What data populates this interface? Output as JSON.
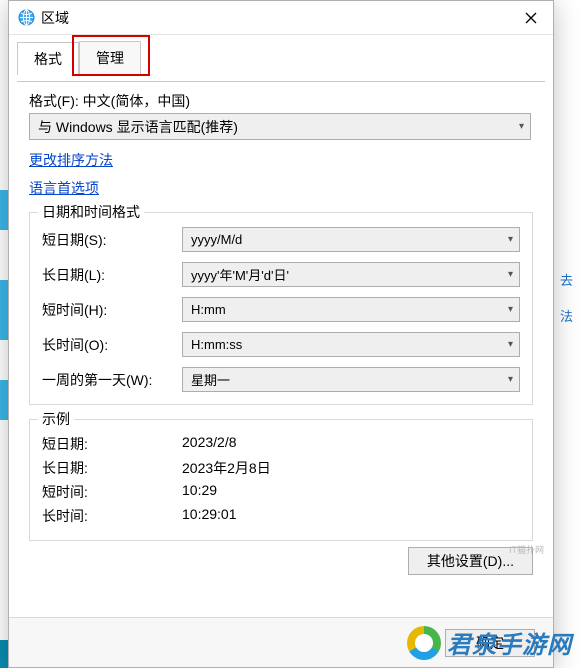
{
  "window": {
    "title": "区域",
    "close_aria": "Close"
  },
  "tabs": {
    "format": "格式",
    "admin": "管理"
  },
  "format_section": {
    "label": "格式(F): 中文(简体，中国)",
    "dropdown_value": "与 Windows 显示语言匹配(推荐)"
  },
  "links": {
    "change_sort": "更改排序方法",
    "language_prefs": "语言首选项"
  },
  "datetime_group": {
    "title": "日期和时间格式",
    "rows": [
      {
        "label": "短日期(S):",
        "value": "yyyy/M/d"
      },
      {
        "label": "长日期(L):",
        "value": "yyyy'年'M'月'd'日'"
      },
      {
        "label": "短时间(H):",
        "value": "H:mm"
      },
      {
        "label": "长时间(O):",
        "value": "H:mm:ss"
      },
      {
        "label": "一周的第一天(W):",
        "value": "星期一"
      }
    ]
  },
  "example_group": {
    "title": "示例",
    "rows": [
      {
        "label": "短日期:",
        "value": "2023/2/8"
      },
      {
        "label": "长日期:",
        "value": "2023年2月8日"
      },
      {
        "label": "短时间:",
        "value": "10:29"
      },
      {
        "label": "长时间:",
        "value": "10:29:01"
      }
    ]
  },
  "buttons": {
    "other_settings": "其他设置(D)...",
    "ok": "确定"
  },
  "background": {
    "link1": "去",
    "link2": "法"
  },
  "watermark": {
    "text": "君泉手游网",
    "tiny": "IT猫扑网"
  }
}
